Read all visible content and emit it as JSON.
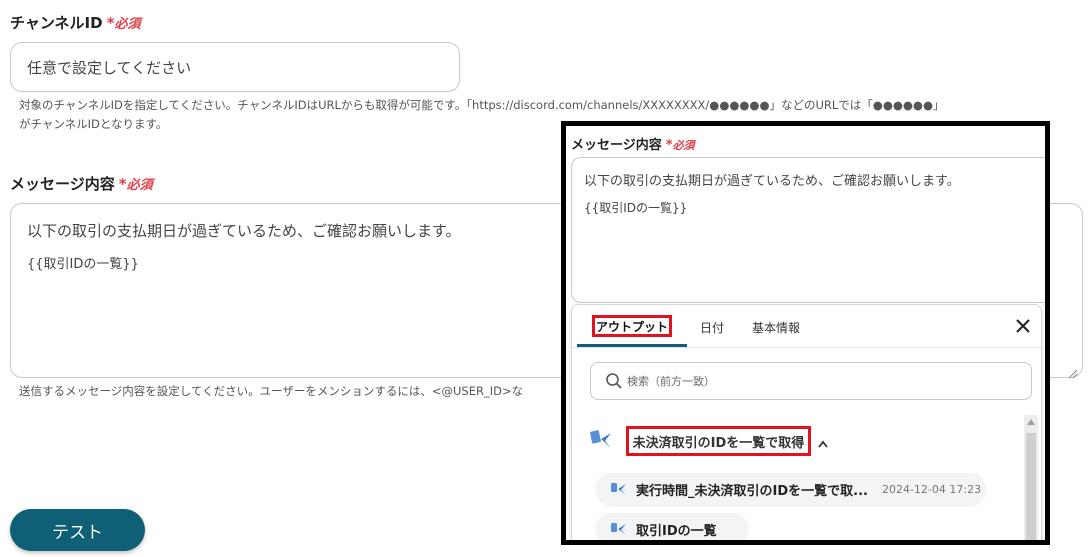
{
  "channel": {
    "label": "チャンネルID",
    "required_star": "*",
    "required_text": "必須",
    "placeholder": "任意で設定してください",
    "help_line1": "対象のチャンネルIDを指定してください。チャンネルIDはURLからも取得が可能です。「https://discord.com/channels/XXXXXXXX/●●●●●●」などのURLでは「●●●●●●」",
    "help_line2": "がチャンネルIDとなります。"
  },
  "message": {
    "label": "メッセージ内容",
    "required_star": "*",
    "required_text": "必須",
    "line1": "以下の取引の支払期日が過ぎているため、ご確認お願いします。",
    "line2": "{{取引IDの一覧}}",
    "help": "送信するメッセージ内容を設定してください。ユーザーをメンションするには、<@USER_ID>な"
  },
  "test_button": "テスト",
  "overlay": {
    "label": "メッセージ内容",
    "required_star": "*",
    "required_text": "必須",
    "line1": "以下の取引の支払期日が過ぎているため、ご確認お願いします。",
    "line2": "{{取引IDの一覧}}",
    "tabs": [
      "アウトプット",
      "日付",
      "基本情報"
    ],
    "close": "×",
    "search_placeholder": "検索（前方一致）",
    "group_title": "未決済取引のIDを一覧で取得",
    "items": [
      {
        "label": "実行時間_未決済取引のIDを一覧で取...",
        "timestamp": "2024-12-04 17:23"
      },
      {
        "label": "取引IDの一覧",
        "timestamp": ""
      }
    ],
    "accent": "#0f6076",
    "highlight": "#e0141e"
  }
}
